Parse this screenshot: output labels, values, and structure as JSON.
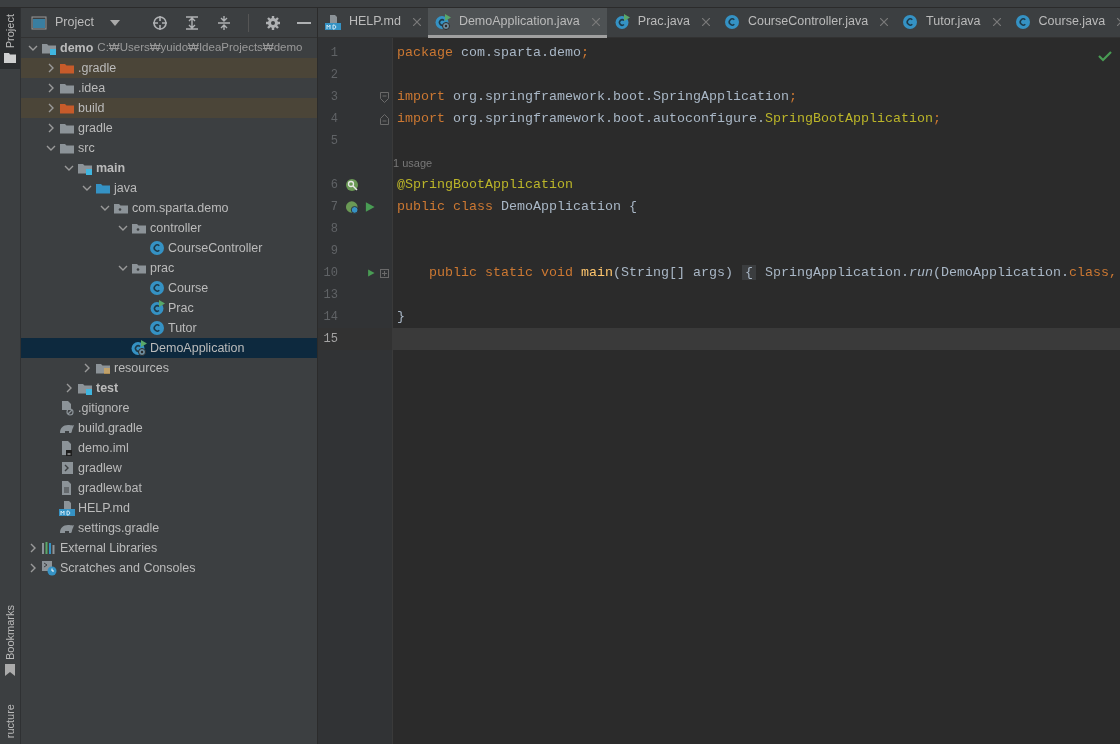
{
  "stripe": {
    "top": [
      {
        "label": "Project",
        "selected": true,
        "kind": "folder"
      }
    ],
    "bottom": [
      {
        "label": "Bookmarks",
        "selected": false,
        "kind": "bookmark"
      },
      {
        "label": "ructure",
        "selected": false
      }
    ]
  },
  "project_panel": {
    "title": "Project",
    "tree": [
      {
        "label": "demo",
        "hint": "C:₩Users₩yuido₩IdeaProjects₩demo",
        "kind": "module",
        "expanded": true,
        "selected": false,
        "children": [
          {
            "label": ".gradle",
            "kind": "excluded",
            "expanded": false,
            "selected": false
          },
          {
            "label": ".idea",
            "kind": "folder",
            "expanded": false,
            "selected": false
          },
          {
            "label": "build",
            "kind": "excluded",
            "expanded": false,
            "selected": false
          },
          {
            "label": "gradle",
            "kind": "folder",
            "expanded": false,
            "selected": false
          },
          {
            "label": "src",
            "kind": "folder",
            "expanded": true,
            "selected": false,
            "children": [
              {
                "label": "main",
                "kind": "module",
                "expanded": true,
                "selected": false,
                "children": [
                  {
                    "label": "java",
                    "kind": "source",
                    "expanded": true,
                    "selected": false,
                    "children": [
                      {
                        "label": "com.sparta.demo",
                        "kind": "package",
                        "expanded": true,
                        "selected": false,
                        "children": [
                          {
                            "label": "controller",
                            "kind": "package",
                            "expanded": true,
                            "selected": false,
                            "children": [
                              {
                                "label": "CourseController",
                                "kind": "class",
                                "selected": false
                              }
                            ]
                          },
                          {
                            "label": "prac",
                            "kind": "package",
                            "expanded": true,
                            "selected": false,
                            "children": [
                              {
                                "label": "Course",
                                "kind": "class",
                                "selected": false
                              },
                              {
                                "label": "Prac",
                                "kind": "class-main",
                                "selected": false
                              },
                              {
                                "label": "Tutor",
                                "kind": "class",
                                "selected": false
                              }
                            ]
                          },
                          {
                            "label": "DemoApplication",
                            "kind": "spring-app",
                            "selected": true
                          }
                        ]
                      }
                    ]
                  },
                  {
                    "label": "resources",
                    "kind": "resources",
                    "expanded": false,
                    "selected": false
                  }
                ]
              },
              {
                "label": "test",
                "kind": "module",
                "expanded": false,
                "selected": false
              }
            ]
          },
          {
            "label": ".gitignore",
            "kind": "ignore",
            "selected": false
          },
          {
            "label": "build.gradle",
            "kind": "gradle",
            "selected": false
          },
          {
            "label": "demo.iml",
            "kind": "iml",
            "selected": false
          },
          {
            "label": "gradlew",
            "kind": "script",
            "selected": false
          },
          {
            "label": "gradlew.bat",
            "kind": "text",
            "selected": false
          },
          {
            "label": "HELP.md",
            "kind": "markdown",
            "selected": false
          },
          {
            "label": "settings.gradle",
            "kind": "gradle",
            "selected": false
          }
        ]
      },
      {
        "label": "External Libraries",
        "kind": "libraries",
        "expanded": false,
        "selected": false
      },
      {
        "label": "Scratches and Consoles",
        "kind": "scratches",
        "expanded": false,
        "selected": false
      }
    ]
  },
  "tabs": [
    {
      "label": "HELP.md",
      "kind": "markdown",
      "selected": false
    },
    {
      "label": "DemoApplication.java",
      "kind": "spring-app",
      "selected": true
    },
    {
      "label": "Prac.java",
      "kind": "class-main",
      "selected": false
    },
    {
      "label": "CourseController.java",
      "kind": "class",
      "selected": false
    },
    {
      "label": "Tutor.java",
      "kind": "class",
      "selected": false
    },
    {
      "label": "Course.java",
      "kind": "class",
      "selected": false
    }
  ],
  "editor": {
    "lines": [
      {
        "number": "1",
        "tokens": [
          {
            "text": "package ",
            "kind": "keyword"
          },
          {
            "text": "com.sparta.demo",
            "kind": "plain"
          },
          {
            "text": ";",
            "kind": "keyword"
          }
        ]
      },
      {
        "number": "2"
      },
      {
        "number": "3",
        "fold_start": true,
        "tokens": [
          {
            "text": "import ",
            "kind": "keyword"
          },
          {
            "text": "org.springframework.boot.SpringApplication",
            "kind": "plain"
          },
          {
            "text": ";",
            "kind": "keyword"
          }
        ]
      },
      {
        "number": "4",
        "fold_end": true,
        "tokens": [
          {
            "text": "import ",
            "kind": "keyword"
          },
          {
            "text": "org.springframework.boot.autoconfigure.",
            "kind": "plain"
          },
          {
            "text": "SpringBootApplication",
            "kind": "annotation"
          },
          {
            "text": ";",
            "kind": "keyword"
          }
        ]
      },
      {
        "number": "5"
      },
      {
        "kind": "hint",
        "text": "1 usage"
      },
      {
        "number": "6",
        "gutter": [
          {
            "kind": "bean-search"
          }
        ],
        "tokens": [
          {
            "text": "@SpringBootApplication",
            "kind": "annotation"
          }
        ]
      },
      {
        "number": "7",
        "gutter": [
          {
            "kind": "bean"
          },
          {
            "kind": "run"
          }
        ],
        "tokens": [
          {
            "text": "public class ",
            "kind": "keyword"
          },
          {
            "text": "DemoApplication {",
            "kind": "plain"
          }
        ]
      },
      {
        "number": "8"
      },
      {
        "number": "9"
      },
      {
        "number": "10",
        "gutter": [
          {
            "kind": "run"
          }
        ],
        "folded": true,
        "tokens": [
          {
            "text": "    public static void ",
            "kind": "keyword"
          },
          {
            "text": "main",
            "kind": "method"
          },
          {
            "text": "(String[] args) ",
            "kind": "plain"
          },
          {
            "text": "{",
            "kind": "folded"
          },
          {
            "text": " SpringApplication.",
            "kind": "plain"
          },
          {
            "text": "run",
            "kind": "italic"
          },
          {
            "text": "(DemoApplication.",
            "kind": "plain"
          },
          {
            "text": "class",
            "kind": "keyword"
          },
          {
            "text": ",",
            "kind": "keyword"
          }
        ]
      },
      {
        "number": "13"
      },
      {
        "number": "14",
        "tokens": [
          {
            "text": "}",
            "kind": "plain"
          }
        ]
      },
      {
        "number": "15",
        "current": true
      }
    ]
  }
}
